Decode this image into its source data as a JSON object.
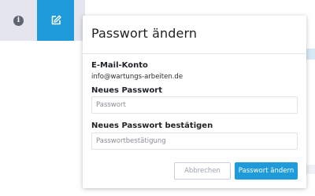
{
  "toolbar": {
    "info_icon_glyph": "i",
    "info_icon": "info-icon",
    "edit_icon": "edit-icon"
  },
  "modal": {
    "title": "Passwort ändern",
    "email_label": "E-Mail-Konto",
    "email_value": "info@wartungs-arbeiten.de",
    "new_password_label": "Neues Passwort",
    "new_password_placeholder": "Passwort",
    "new_password_value": "",
    "confirm_password_label": "Neues Passwort bestätigen",
    "confirm_password_placeholder": "Passwortbestätigung",
    "confirm_password_value": "",
    "cancel_label": "Abbrechen",
    "save_label": "Passwort ändern"
  },
  "colors": {
    "accent": "#1e9bd8",
    "toolbar_bg": "#e4e5ee",
    "cancel_text": "#9aa1b3"
  }
}
